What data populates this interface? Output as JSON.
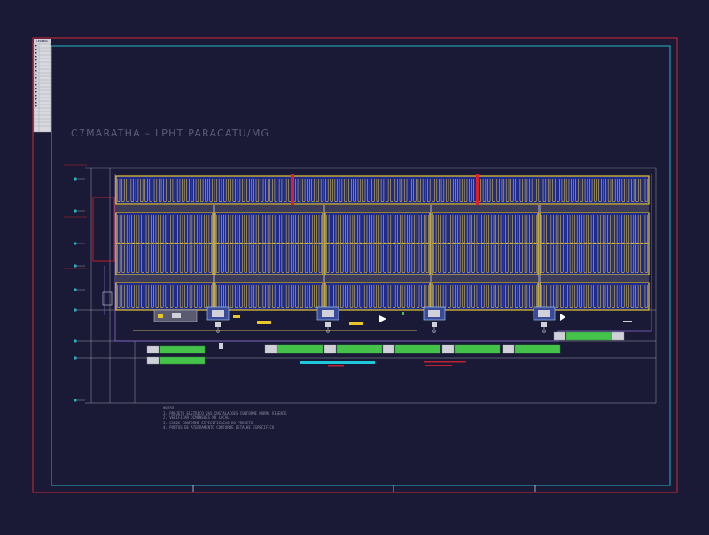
{
  "drawing": {
    "title": "C7MARATHA – LPHT PARACATU/MG",
    "notes_heading": "NOTAS:",
    "notes": [
      "1. PROJETO ELETRICO DAS INSTALACOES CONFORME NORMA VIGENTE",
      "2. VERIFICAR DIMENSOES NO LOCAL",
      "3. CABOS CONFORME ESPECIFICACAO DO PROJETO",
      "4. PONTOS DE ATERRAMENTO CONFORME DETALHE ESPECIFICO"
    ],
    "table_header": "LEGENDA"
  },
  "layout_colors": {
    "background": "#1a1a36",
    "outer_border": "#d02a3c",
    "inner_border": "#22b6c4",
    "panel_fill": "#1e2a8c",
    "panel_frame": "#e8c62a",
    "strings": "#e8c62a",
    "green_blocks": "#44c24a",
    "red_bars": "#e01e2a",
    "cyan_bar": "#1ec8d8",
    "grey_lines": "#9a9aa8"
  },
  "inverter_stations": {
    "count": 5
  },
  "green_blocks": {
    "count": 8
  }
}
